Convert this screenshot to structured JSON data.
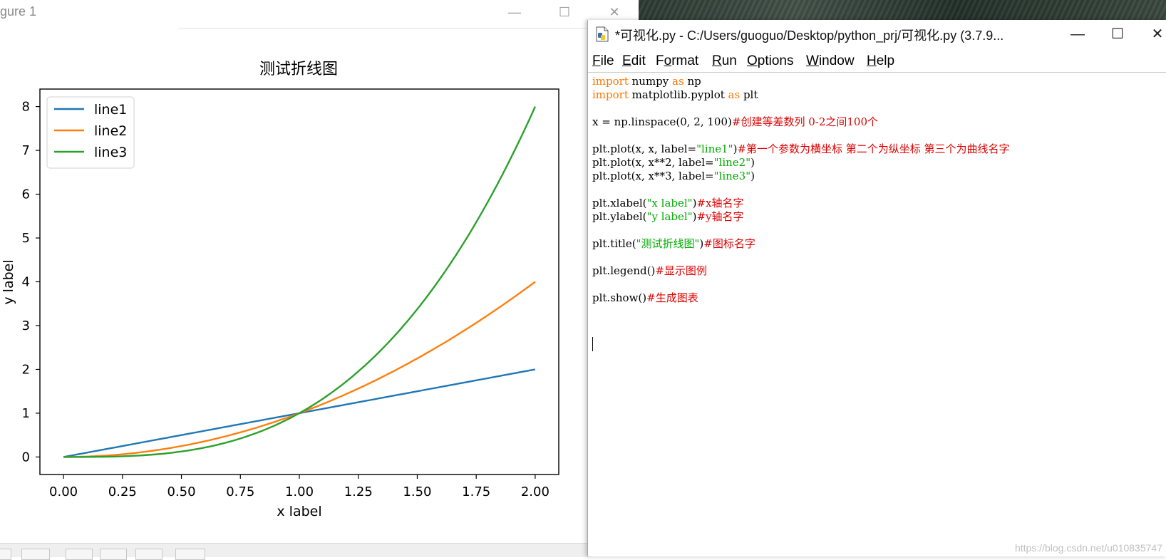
{
  "figure_window": {
    "title": "gure 1",
    "controls": {
      "minimize": "—",
      "maximize": "☐",
      "close": "✕"
    }
  },
  "chart_data": {
    "type": "line",
    "title": "测试折线图",
    "xlabel": "x label",
    "ylabel": "y label",
    "xlim": [
      -0.1,
      2.1
    ],
    "ylim": [
      -0.4,
      8.4
    ],
    "xticks": [
      0,
      0.25,
      0.5,
      0.75,
      1.0,
      1.25,
      1.5,
      1.75,
      2.0
    ],
    "xtick_labels": [
      "0.00",
      "0.25",
      "0.50",
      "0.75",
      "1.00",
      "1.25",
      "1.50",
      "1.75",
      "2.00"
    ],
    "yticks": [
      0,
      1,
      2,
      3,
      4,
      5,
      6,
      7,
      8
    ],
    "ytick_labels": [
      "0",
      "1",
      "2",
      "3",
      "4",
      "5",
      "6",
      "7",
      "8"
    ],
    "legend_position": "top-left",
    "grid": false,
    "series": [
      {
        "name": "line1",
        "color": "#1f77b4",
        "x": [
          0,
          0.25,
          0.5,
          0.75,
          1.0,
          1.25,
          1.5,
          1.75,
          2.0
        ],
        "y": [
          0,
          0.25,
          0.5,
          0.75,
          1.0,
          1.25,
          1.5,
          1.75,
          2.0
        ]
      },
      {
        "name": "line2",
        "color": "#ff7f0e",
        "x": [
          0,
          0.25,
          0.5,
          0.75,
          1.0,
          1.25,
          1.5,
          1.75,
          2.0
        ],
        "y": [
          0,
          0.0625,
          0.25,
          0.5625,
          1.0,
          1.5625,
          2.25,
          3.0625,
          4.0
        ]
      },
      {
        "name": "line3",
        "color": "#2ca02c",
        "x": [
          0,
          0.25,
          0.5,
          0.75,
          1.0,
          1.25,
          1.5,
          1.75,
          2.0
        ],
        "y": [
          0,
          0.015625,
          0.125,
          0.421875,
          1.0,
          1.953125,
          3.375,
          5.359375,
          8.0
        ]
      }
    ]
  },
  "idle": {
    "title": "*可视化.py - C:/Users/guoguo/Desktop/python_prj/可视化.py (3.7.9...",
    "controls": {
      "minimize": "—",
      "maximize": "☐",
      "close": "✕"
    },
    "menu": [
      {
        "mnemonic": "F",
        "rest": "ile"
      },
      {
        "mnemonic": "E",
        "rest": "dit"
      },
      {
        "prefix": "F",
        "mnemonic": "o",
        "rest": "rmat"
      },
      {
        "mnemonic": "R",
        "rest": "un"
      },
      {
        "mnemonic": "O",
        "rest": "ptions"
      },
      {
        "mnemonic": "W",
        "rest": "indow"
      },
      {
        "mnemonic": "H",
        "rest": "elp"
      }
    ],
    "code": [
      [
        [
          "import",
          "kw"
        ],
        [
          " numpy ",
          ""
        ],
        [
          "as",
          "kw"
        ],
        [
          " np",
          ""
        ]
      ],
      [
        [
          "import",
          "kw"
        ],
        [
          " matplotlib.pyplot ",
          ""
        ],
        [
          "as",
          "kw"
        ],
        [
          " plt",
          ""
        ]
      ],
      [],
      [
        [
          "x = np.linspace(0, 2, 100)",
          ""
        ],
        [
          "#创建等差数列 0-2之间100个",
          "cmt"
        ]
      ],
      [],
      [
        [
          "plt.plot(x, x, label=",
          ""
        ],
        [
          "\"line1\"",
          "str"
        ],
        [
          ")",
          ""
        ],
        [
          "#第一个参数为横坐标 第二个为纵坐标 第三个为曲线名字",
          "cmt"
        ]
      ],
      [
        [
          "plt.plot(x, x**2, label=",
          ""
        ],
        [
          "\"line2\"",
          "str"
        ],
        [
          ")",
          ""
        ]
      ],
      [
        [
          "plt.plot(x, x**3, label=",
          ""
        ],
        [
          "\"line3\"",
          "str"
        ],
        [
          ")",
          ""
        ]
      ],
      [],
      [
        [
          "plt.xlabel(",
          ""
        ],
        [
          "\"x label\"",
          "str"
        ],
        [
          ")",
          ""
        ],
        [
          "#x轴名字",
          "cmt"
        ]
      ],
      [
        [
          "plt.ylabel(",
          ""
        ],
        [
          "\"y label\"",
          "str"
        ],
        [
          ")",
          ""
        ],
        [
          "#y轴名字",
          "cmt"
        ]
      ],
      [],
      [
        [
          "plt.title(",
          ""
        ],
        [
          "\"测试折线图\"",
          "str"
        ],
        [
          ")",
          ""
        ],
        [
          "#图标名字",
          "cmt"
        ]
      ],
      [],
      [
        [
          "plt.legend()",
          ""
        ],
        [
          "#显示图例",
          "cmt"
        ]
      ],
      [],
      [
        [
          "plt.show()",
          ""
        ],
        [
          "#生成图表",
          "cmt"
        ]
      ]
    ]
  },
  "watermark": "https://blog.csdn.net/u010835747"
}
